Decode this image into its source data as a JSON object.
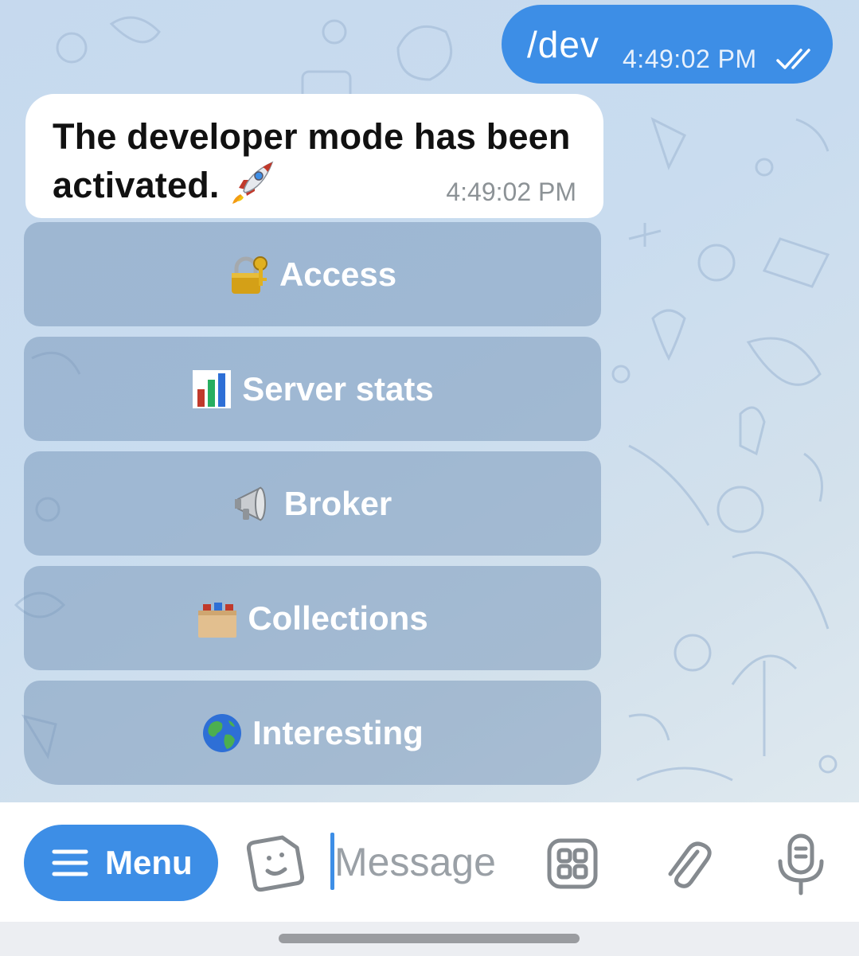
{
  "outgoing": {
    "text": "/dev",
    "time": "4:49:02 PM"
  },
  "incoming": {
    "text": "The developer mode has been activated.",
    "time": "4:49:02 PM"
  },
  "keyboard": [
    {
      "label": "Access",
      "icon": "lock-key-icon"
    },
    {
      "label": "Server stats",
      "icon": "bar-chart-icon"
    },
    {
      "label": "Broker",
      "icon": "megaphone-icon"
    },
    {
      "label": "Collections",
      "icon": "card-file-box-icon"
    },
    {
      "label": "Interesting",
      "icon": "globe-icon"
    }
  ],
  "input_bar": {
    "menu_label": "Menu",
    "placeholder": "Message"
  },
  "colors": {
    "accent": "#3d8ee6",
    "outgoing_bubble": "#3d8ee6",
    "incoming_bubble": "#ffffff",
    "keyboard_button": "#8aa6c4"
  }
}
